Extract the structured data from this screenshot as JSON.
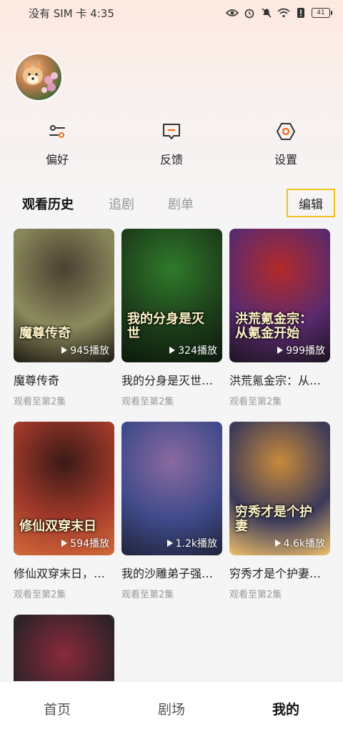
{
  "status_bar": {
    "carrier_time": "没有 SIM 卡 4:35",
    "battery": "41",
    "icons": [
      "eye-icon",
      "alarm-icon",
      "mute-icon",
      "wifi-icon",
      "alert-icon",
      "battery-icon"
    ]
  },
  "actions": [
    {
      "label": "偏好",
      "icon": "preferences-icon"
    },
    {
      "label": "反馈",
      "icon": "feedback-icon"
    },
    {
      "label": "设置",
      "icon": "settings-icon"
    }
  ],
  "tabs": {
    "items": [
      "观看历史",
      "追剧",
      "剧单"
    ],
    "edit_label": "编辑"
  },
  "dramas": [
    {
      "title": "魔尊传奇",
      "plays": "945播放",
      "progress": "观看至第2集",
      "art": "魔尊传奇",
      "colors": [
        "#8c8a5c",
        "#4a4032",
        "#1e1a14"
      ]
    },
    {
      "title": "我的分身是灭世…",
      "plays": "324播放",
      "progress": "观看至第2集",
      "art": "我的分身是灭世",
      "colors": [
        "#1d3d1a",
        "#2f7a2a",
        "#0b1a0b"
      ]
    },
    {
      "title": "洪荒氪金宗：从…",
      "plays": "999播放",
      "progress": "观看至第2集",
      "art": "洪荒氪金宗：从氪金开始",
      "colors": [
        "#5a2a6e",
        "#b32a2a",
        "#1c1420"
      ]
    },
    {
      "title": "修仙双穿末日，…",
      "plays": "594播放",
      "progress": "观看至第2集",
      "art": "修仙双穿末日",
      "colors": [
        "#a33a2a",
        "#3a1a16",
        "#d26a3a"
      ]
    },
    {
      "title": "我的沙雕弟子强…",
      "plays": "1.2k播放",
      "progress": "观看至第2集",
      "art": "",
      "colors": [
        "#3f4a8a",
        "#8a6aa0",
        "#20243a"
      ]
    },
    {
      "title": "穷秀才是个护妻…",
      "plays": "4.6k播放",
      "progress": "观看至第2集",
      "art": "穷秀才是个护妻",
      "colors": [
        "#3a3a5a",
        "#c98a3a",
        "#f2c06a"
      ]
    },
    {
      "title": "",
      "plays": "",
      "progress": "",
      "art": "",
      "colors": [
        "#2a2228",
        "#8a2a3a",
        "#d0c8d0"
      ]
    }
  ],
  "bottom_nav": [
    "首页",
    "剧场",
    "我的"
  ]
}
